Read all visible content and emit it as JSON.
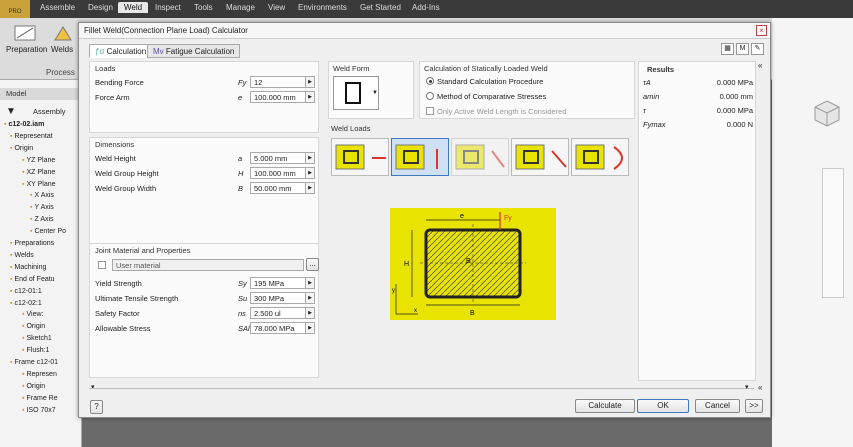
{
  "app": {
    "logo": "PRO",
    "ribbon_tabs": [
      "Assemble",
      "Design",
      "Weld",
      "Inspect",
      "Tools",
      "Manage",
      "View",
      "Environments",
      "Get Started",
      "Add-Ins"
    ],
    "active_tab": "Weld",
    "ribbon_buttons": [
      "Preparation",
      "Welds"
    ],
    "panel_label": "Process"
  },
  "browser": {
    "header": "Model",
    "assembly_label": "Assembly",
    "items": [
      "c12-02.iam",
      "Representat",
      "Origin",
      "YZ Plane",
      "XZ Plane",
      "XY Plane",
      "X Axis",
      "Y Axis",
      "Z Axis",
      "Center Po",
      "Preparations",
      "Welds",
      "Machining",
      "End of Featu",
      "c12-01:1",
      "c12-02:1",
      "View:",
      "Origin",
      "Sketch1",
      "Flush:1",
      "Frame c12-01",
      "Represen",
      "Origin",
      "Frame Re",
      "ISO 70x7"
    ]
  },
  "dialog": {
    "title": "Fillet Weld(Connection Plane Load) Calculator",
    "close": "×",
    "tabs": [
      "Calculation",
      "Fatigue Calculation"
    ],
    "loads": {
      "title": "Loads",
      "rows": [
        {
          "label": "Bending Force",
          "sym": "Fy",
          "value": "12"
        },
        {
          "label": "Force Arm",
          "sym": "e",
          "value": "100.000 mm"
        }
      ]
    },
    "dimensions": {
      "title": "Dimensions",
      "rows": [
        {
          "label": "Weld Height",
          "sym": "a",
          "value": "5.000 mm"
        },
        {
          "label": "Weld Group Height",
          "sym": "H",
          "value": "100.000 mm"
        },
        {
          "label": "Weld Group Width",
          "sym": "B",
          "value": "50.000 mm"
        }
      ]
    },
    "material": {
      "title": "Joint Material and Properties",
      "user_material": "User material",
      "rows": [
        {
          "label": "Yield Strength",
          "sym": "Sy",
          "value": "195 MPa"
        },
        {
          "label": "Ultimate Tensile Strength",
          "sym": "Su",
          "value": "300 MPa"
        },
        {
          "label": "Safety Factor",
          "sym": "ns",
          "value": "2.500 ul"
        },
        {
          "label": "Allowable Stress",
          "sym": "SAl",
          "value": "78.000 MPa"
        }
      ],
      "browse": "..."
    },
    "weld_form": {
      "title": "Weld Form"
    },
    "calc_method": {
      "title": "Calculation of Statically Loaded Weld",
      "options": [
        "Standard Calculation Procedure",
        "Method of Comparative Stresses"
      ],
      "checkbox": "Only Active Weld Length is Considered"
    },
    "weld_loads": {
      "title": "Weld Loads"
    },
    "diagram": {
      "e": "e",
      "fy": "Fy",
      "h": "H",
      "b": "B",
      "b2": "B",
      "y": "y",
      "x": "x"
    },
    "results": {
      "title": "Results",
      "rows": [
        {
          "sym": "τA",
          "value": "0.000 MPa"
        },
        {
          "sym": "amin",
          "value": "0.000 mm"
        },
        {
          "sym": "τ",
          "value": "0.000 MPa"
        },
        {
          "sym": "Fymax",
          "value": "0.000 N"
        }
      ]
    },
    "buttons": {
      "help": "?",
      "calculate": "Calculate",
      "ok": "OK",
      "cancel": "Cancel",
      "more": ">>"
    }
  },
  "colors": {
    "weld_yellow": "#e8e300",
    "selected_blue": "#3c79c0",
    "arrow_red": "#d9372b"
  }
}
